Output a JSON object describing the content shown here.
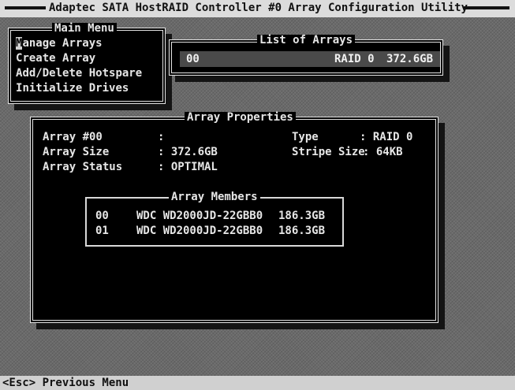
{
  "title": "Adaptec SATA HostRAID Controller #0 Array Configuration Utility",
  "main_menu": {
    "title": "Main Menu",
    "items": [
      {
        "hotkey": "M",
        "rest": "anage Arrays",
        "selected": true
      },
      {
        "hotkey": "C",
        "rest": "reate Array",
        "selected": false
      },
      {
        "hotkey": "A",
        "rest": "dd/Delete Hotspare",
        "selected": false
      },
      {
        "hotkey": "I",
        "rest": "nitialize Drives",
        "selected": false
      }
    ]
  },
  "list_of_arrays": {
    "title": "List of Arrays",
    "rows": [
      {
        "id": "00",
        "raid": "RAID 0",
        "size": "372.6GB"
      }
    ]
  },
  "array_properties": {
    "title": "Array Properties",
    "array_label": "Array #00",
    "array_value": ":",
    "size_label": "Array Size",
    "size_value": ": 372.6GB",
    "status_label": "Array Status",
    "status_value": ": OPTIMAL",
    "type_label": "Type",
    "type_value": ": RAID 0",
    "stripe_label": "Stripe Size",
    "stripe_value": ": 64KB"
  },
  "array_members": {
    "title": "Array Members",
    "rows": [
      {
        "id": "00",
        "model": "WDC WD2000JD-22GBB0",
        "size": "186.3GB"
      },
      {
        "id": "01",
        "model": "WDC WD2000JD-22GBB0",
        "size": "186.3GB"
      }
    ]
  },
  "footer": "<Esc> Previous Menu",
  "colors": {
    "screen_bg": "#000000",
    "highlight_bg": "#d0d0d0",
    "selected_row_bg": "#4a4a4a",
    "text": "#e6e6e6"
  }
}
